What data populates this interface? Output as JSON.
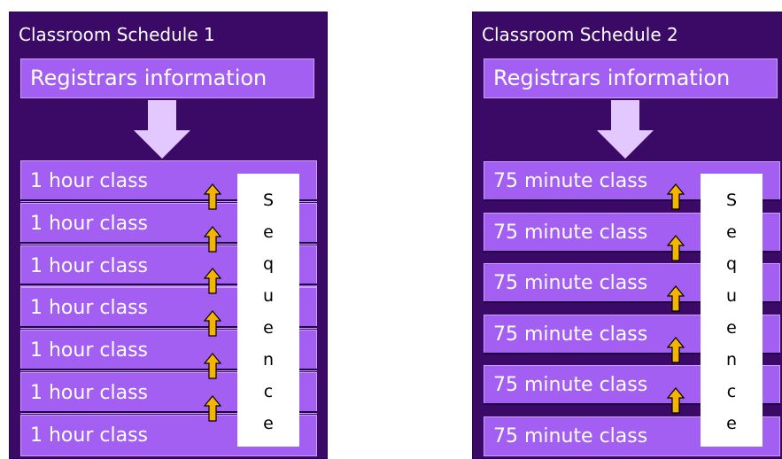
{
  "schedules": [
    {
      "title": "Classroom Schedule 1",
      "registrars": "Registrars information",
      "classes": [
        "1 hour class",
        "1 hour class",
        "1 hour class",
        "1 hour class",
        "1 hour class",
        "1 hour class",
        "1 hour class"
      ],
      "sequence": [
        "S",
        "e",
        "q",
        "u",
        "e",
        "n",
        "c",
        "e"
      ]
    },
    {
      "title": "Classroom Schedule 2",
      "registrars": "Registrars information",
      "classes": [
        "75 minute class",
        "75 minute class",
        "75 minute class",
        "75 minute class",
        "75 minute class",
        "75 minute class"
      ],
      "sequence": [
        "S",
        "e",
        "q",
        "u",
        "e",
        "n",
        "c",
        "e"
      ]
    }
  ],
  "colors": {
    "panel": "#3b0a66",
    "box": "#a25ff2",
    "down_arrow": "#e3c8ff",
    "up_arrow": "#f5b400"
  }
}
